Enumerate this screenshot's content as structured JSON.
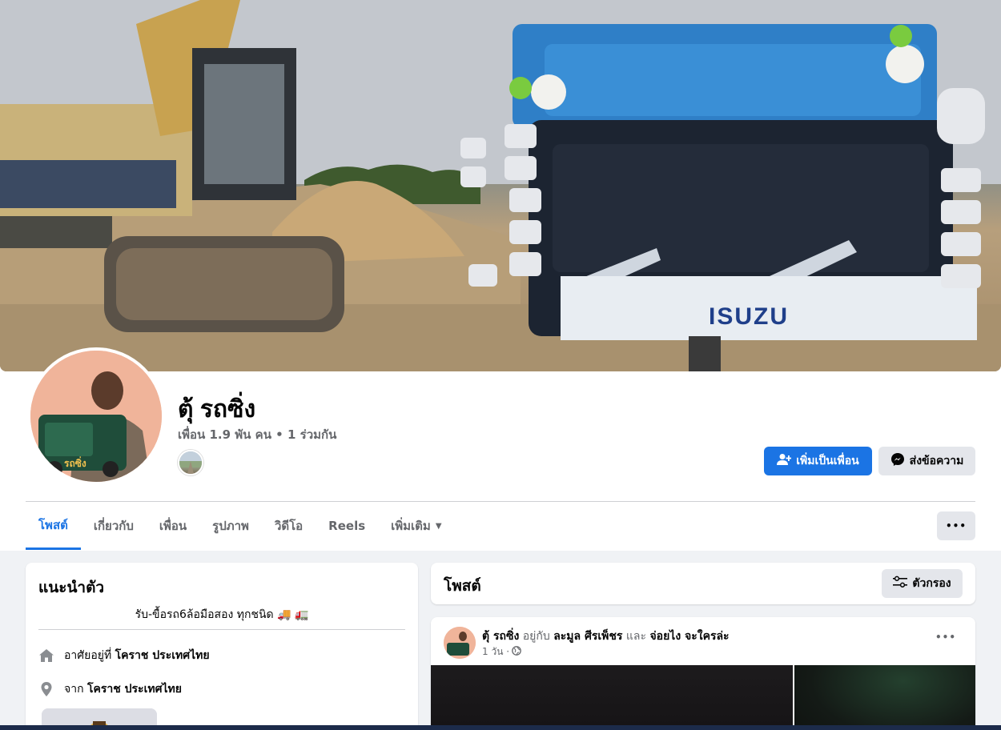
{
  "profile": {
    "name": "ตุ้ รถซิ่ง",
    "friends_line": "เพื่อน 1.9 พัน คน • 1 ร่วมกัน",
    "add_friend_label": "เพิ่มเป็นเพื่อน",
    "message_label": "ส่งข้อความ",
    "more_label": "•••",
    "cover_truck_brand": "ISUZU",
    "avatar_text": "รถซิ่ง"
  },
  "tabs": [
    {
      "label": "โพสต์",
      "active": true
    },
    {
      "label": "เกี่ยวกับ"
    },
    {
      "label": "เพื่อน"
    },
    {
      "label": "รูปภาพ"
    },
    {
      "label": "วิดีโอ"
    },
    {
      "label": "Reels"
    },
    {
      "label": "เพิ่มเติม"
    }
  ],
  "tabs_caret": "▼",
  "intro": {
    "title": "แนะนำตัว",
    "bio": "รับ-ขื้อรถ6ล้อมือสอง ทุกชนิด 🚚 🚛",
    "lives_prefix": "อาศัยอยู่ที่",
    "lives_place": "โคราช ประเทศไทย",
    "from_prefix": "จาก",
    "from_place": "โคราช ประเทศไทย"
  },
  "posts_header": {
    "title": "โพสต์",
    "filter_label": "ตัวกรอง"
  },
  "post": {
    "author": "ตุ้ รถซิ่ง",
    "with_word": "อยู่กับ",
    "tag1": "ละมูล ศีรเพ็ชร",
    "and_word": "และ",
    "tag2": "จ่อยไง จะใครล่ะ",
    "time": "1 วัน ·",
    "more_label": "•••"
  },
  "colors": {
    "accent": "#1b74e4",
    "background": "#f0f2f5",
    "secondary_button": "#e4e6eb",
    "muted_text": "#65676b"
  }
}
